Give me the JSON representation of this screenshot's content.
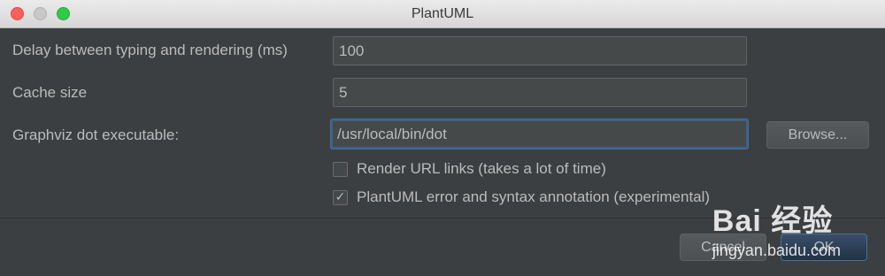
{
  "window": {
    "title": "PlantUML"
  },
  "form": {
    "delay": {
      "label": "Delay between typing and rendering (ms)",
      "value": "100"
    },
    "cache": {
      "label": "Cache size",
      "value": "5"
    },
    "graphviz": {
      "label": "Graphviz dot executable:",
      "value": "/usr/local/bin/dot",
      "browse_label": "Browse..."
    },
    "render_links": {
      "label": "Render URL links (takes a lot of time)",
      "checked": false
    },
    "annotation": {
      "label": "PlantUML error and syntax annotation (experimental)",
      "checked": true
    }
  },
  "footer": {
    "cancel_label": "Cancel",
    "ok_label": "OK"
  },
  "watermark": {
    "logo": "Bai 经验",
    "url": "jingyan.baidu.com"
  },
  "colors": {
    "background": "#3c3f41",
    "field_bg": "#45494a",
    "focus_border": "#3d6185",
    "ok_button": "#233143"
  }
}
